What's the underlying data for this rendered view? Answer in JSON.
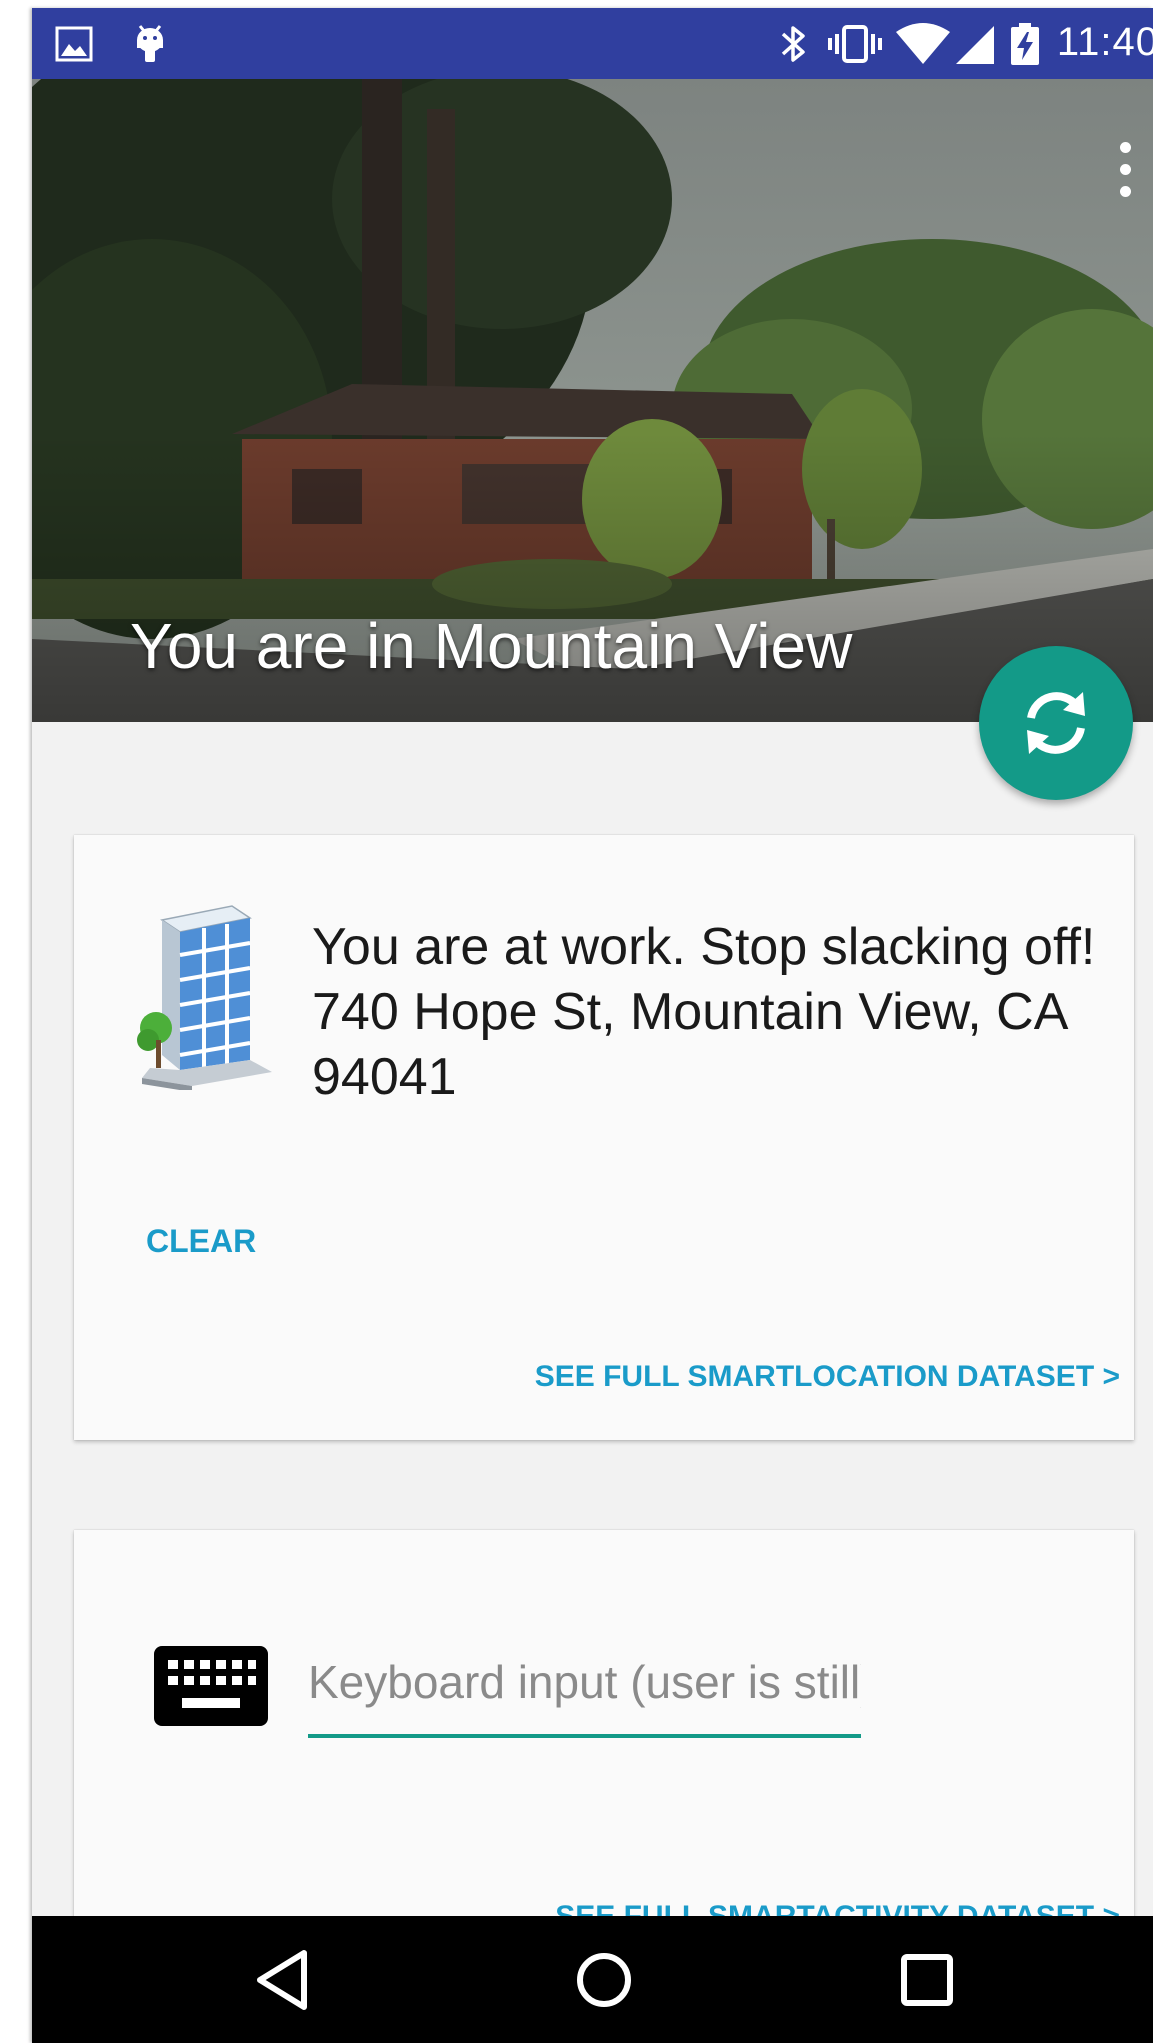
{
  "status_bar": {
    "time": "11:40",
    "left_icons": [
      "image-icon",
      "android-debug-icon"
    ],
    "right_icons": [
      "bluetooth-icon",
      "vibrate-icon",
      "wifi-icon",
      "cell-signal-icon",
      "battery-charging-icon"
    ],
    "background_color": "#303f9f"
  },
  "hero": {
    "title": "You are in Mountain View",
    "menu_icon": "more-vert-icon",
    "fab_icon": "refresh-icon",
    "fab_color": "#139a88"
  },
  "location_card": {
    "icon": "office-building-icon",
    "message": "You are at work. Stop slacking off! 740 Hope St, Mountain View, CA 94041",
    "clear_label": "CLEAR",
    "see_full_label": "SEE FULL SMARTLOCATION DATASET >"
  },
  "activity_card": {
    "icon": "keyboard-icon",
    "input_placeholder": "Keyboard input (user is still)",
    "input_value": "",
    "see_full_label": "SEE FULL SMARTACTIVITY DATASET >"
  },
  "nav_bar": {
    "buttons": [
      "back-icon",
      "home-icon",
      "recents-icon"
    ]
  },
  "colors": {
    "accent": "#139a88",
    "link": "#1a9bc9"
  }
}
